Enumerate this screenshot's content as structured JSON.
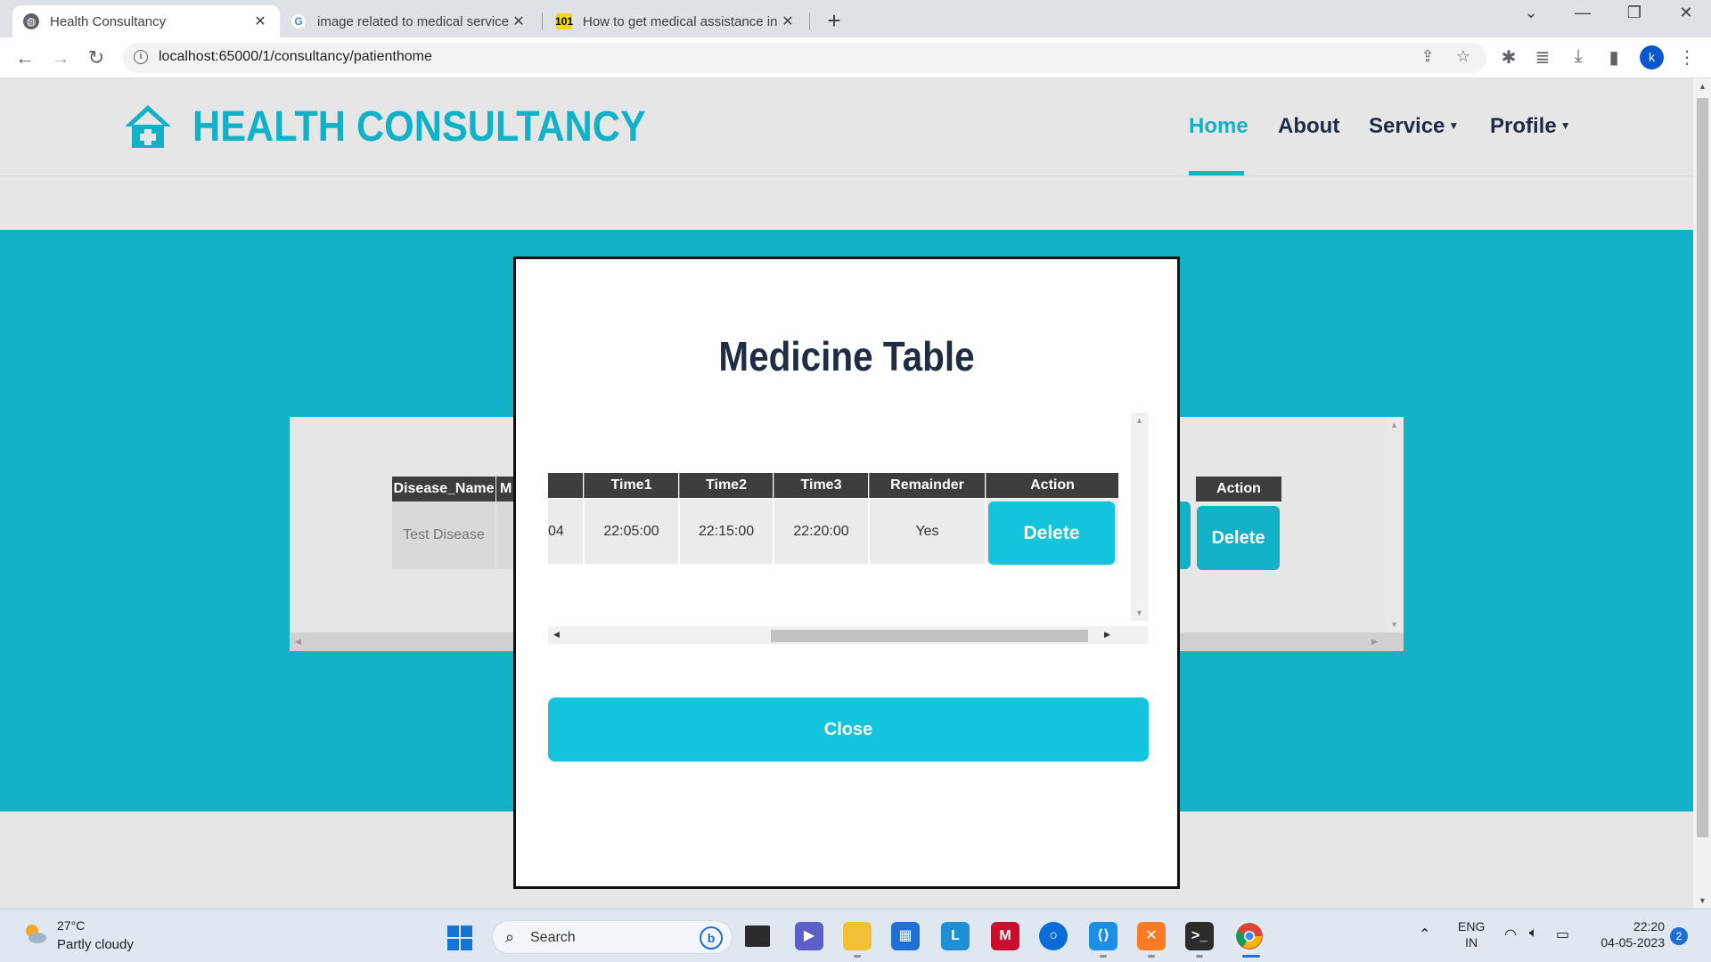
{
  "browser": {
    "tabs": [
      {
        "title": "Health Consultancy",
        "active": true
      },
      {
        "title": "image related to medical services",
        "active": false
      },
      {
        "title": "How to get medical assistance in",
        "active": false
      }
    ],
    "new_tab": "+",
    "address": "localhost:65000/1/consultancy/patienthome",
    "profile_initial": "k",
    "accent": "#13b1c8"
  },
  "site": {
    "brand": "HEALTH CONSULTANCY",
    "nav": [
      {
        "label": "Home",
        "active": true
      },
      {
        "label": "About"
      },
      {
        "label": "Service",
        "dropdown": true
      },
      {
        "label": "Profile",
        "dropdown": true
      }
    ]
  },
  "background_table": {
    "headers": [
      "Disease_Name",
      "M",
      "Action"
    ],
    "rows": [
      {
        "disease_name": "Test Disease",
        "action": "Delete"
      }
    ]
  },
  "modal": {
    "title": "Medicine Table",
    "columns": [
      "Time1",
      "Time2",
      "Time3",
      "Remainder",
      "Action"
    ],
    "rows": [
      {
        "clipped": "04",
        "time1": "22:05:00",
        "time2": "22:15:00",
        "time3": "22:20:00",
        "remainder": "Yes",
        "action": "Delete"
      }
    ],
    "close_label": "Close"
  },
  "taskbar": {
    "weather": {
      "temp": "27°C",
      "desc": "Partly cloudy"
    },
    "search_placeholder": "Search",
    "lang": {
      "line1": "ENG",
      "line2": "IN"
    },
    "time": "22:20",
    "date": "04-05-2023",
    "notifications": "2"
  }
}
